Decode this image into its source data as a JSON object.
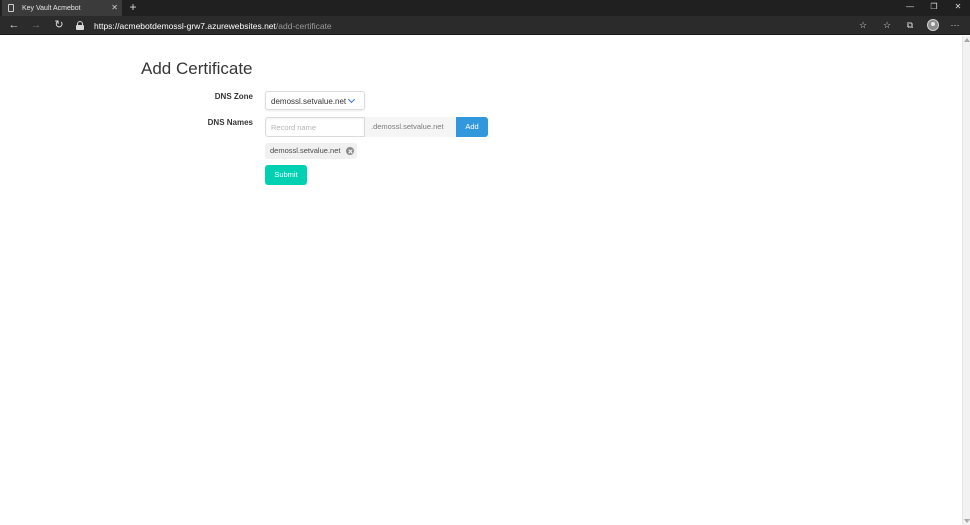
{
  "browser": {
    "tab_title": "Key Vault Acmebot",
    "url_host": "https://acmebotdemossl-grw7.azurewebsites.net",
    "url_path": "/add-certificate"
  },
  "page": {
    "title": "Add Certificate",
    "dns_zone": {
      "label": "DNS Zone",
      "selected": "demossl.setvalue.net"
    },
    "dns_names": {
      "label": "DNS Names",
      "placeholder": "Record name",
      "suffix": ".demossl.setvalue.net",
      "add_label": "Add",
      "tags": [
        "demossl.setvalue.net"
      ]
    },
    "submit_label": "Submit"
  }
}
